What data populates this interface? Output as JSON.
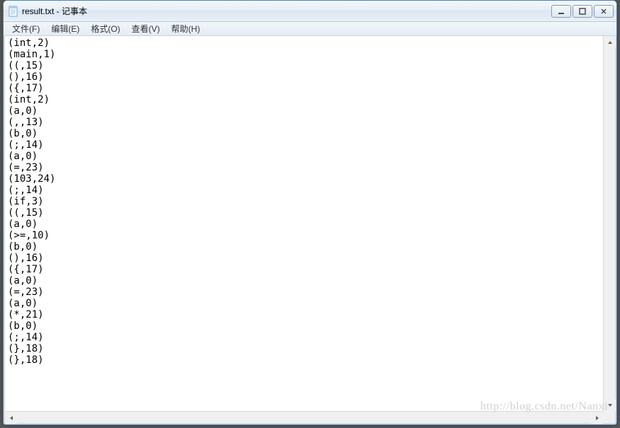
{
  "window": {
    "title": "result.txt - 记事本"
  },
  "menu": {
    "file": "文件(F)",
    "edit": "编辑(E)",
    "format": "格式(O)",
    "view": "查看(V)",
    "help": "帮助(H)"
  },
  "content_lines": [
    "(int,2)",
    "(main,1)",
    "((,15)",
    "(),16)",
    "({,17)",
    "(int,2)",
    "(a,0)",
    "(,,13)",
    "(b,0)",
    "(;,14)",
    "(a,0)",
    "(=,23)",
    "(103,24)",
    "(;,14)",
    "(if,3)",
    "((,15)",
    "(a,0)",
    "(>=,10)",
    "(b,0)",
    "(),16)",
    "({,17)",
    "(a,0)",
    "(=,23)",
    "(a,0)",
    "(*,21)",
    "(b,0)",
    "(;,14)",
    "(},18)",
    "(},18)"
  ],
  "watermark": "http://blog.csdn.net/Nanxi"
}
